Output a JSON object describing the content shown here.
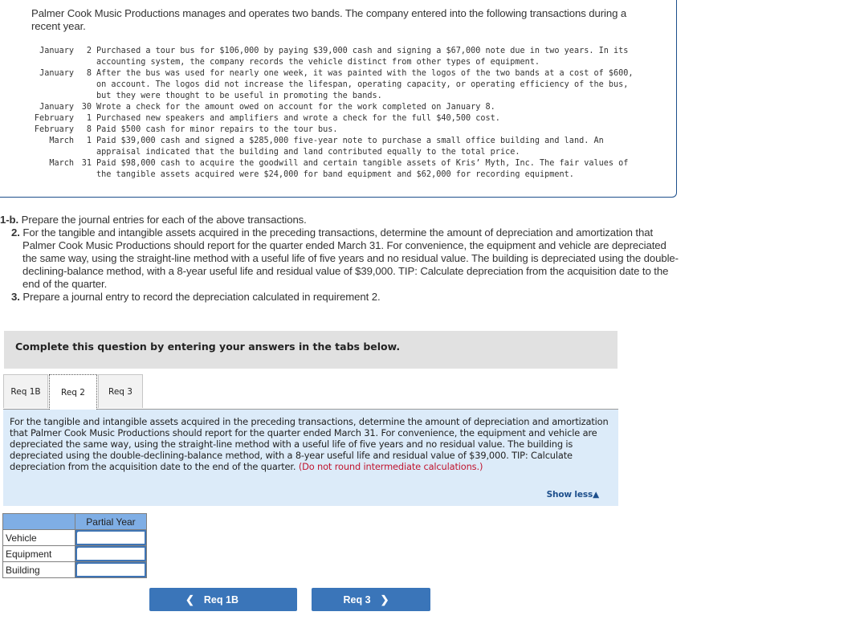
{
  "problem": {
    "intro": "Palmer Cook Music Productions manages and operates two bands. The company entered into the following transactions during a recent year.",
    "transactions": [
      {
        "month": "January",
        "day": "2",
        "description": "Purchased a tour bus for $106,000 by paying $39,000 cash and signing a $67,000 note due in two years. In its accounting system, the company records the vehicle distinct from other types of equipment."
      },
      {
        "month": "January",
        "day": "8",
        "description": "After the bus was used for nearly one week, it was painted with the logos of the two bands at a cost of $600, on account. The logos did not increase the lifespan, operating capacity, or operating efficiency of the bus, but they were thought to be useful in promoting the bands."
      },
      {
        "month": "January",
        "day": "30",
        "description": "Wrote a check for the amount owed on account for the work completed on January 8."
      },
      {
        "month": "February",
        "day": "1",
        "description": "Purchased new speakers and amplifiers and wrote a check for the full $40,500 cost."
      },
      {
        "month": "February",
        "day": "8",
        "description": "Paid $500 cash for minor repairs to the tour bus."
      },
      {
        "month": "March",
        "day": "1",
        "description": "Paid $39,000 cash and signed a $285,000 five-year note to purchase a small office building and land. An appraisal indicated that the building and land contributed equally to the total price."
      },
      {
        "month": "March",
        "day": "31",
        "description": "Paid $98,000 cash to acquire the goodwill and certain tangible assets of Kris’ Myth, Inc. The fair values of the tangible assets acquired were $24,000 for band equipment and $62,000 for recording equipment."
      }
    ]
  },
  "requirements": [
    {
      "label": "1-b.",
      "text": "Prepare the journal entries for each of the above transactions."
    },
    {
      "label": "2.",
      "text": "For the tangible and intangible assets acquired in the preceding transactions, determine the amount of depreciation and amortization that Palmer Cook Music Productions should report for the quarter ended March 31. For convenience, the equipment and vehicle are depreciated the same way, using the straight-line method with a useful life of five years and no residual value. The building is depreciated using the double-declining-balance method, with a 8-year useful life and residual value of $39,000. TIP: Calculate depreciation from the acquisition date to the end of the quarter."
    },
    {
      "label": "3.",
      "text": "Prepare a journal entry to record the depreciation calculated in requirement 2."
    }
  ],
  "complete_bar": "Complete this question by entering your answers in the tabs below.",
  "tabs": [
    {
      "label": "Req 1B",
      "active": false
    },
    {
      "label": "Req 2",
      "active": true
    },
    {
      "label": "Req 3",
      "active": false
    }
  ],
  "instructions": {
    "text": "For the tangible and intangible assets acquired in the preceding transactions, determine the amount of depreciation and amortization that Palmer Cook Music Productions should report for the quarter ended March 31. For convenience, the equipment and vehicle are depreciated the same way, using the straight-line method with a useful life of five years and no residual value. The building is depreciated using the double-declining-balance method, with a 8-year useful life and residual value of $39,000. TIP: Calculate depreciation from the acquisition date to the end of the quarter.",
    "warning": "(Do not round intermediate calculations.)",
    "show_less": "Show less",
    "show_less_icon": "triangle-up-icon"
  },
  "answer_table": {
    "column_header": "Partial Year",
    "rows": [
      {
        "label": "Vehicle",
        "value": ""
      },
      {
        "label": "Equipment",
        "value": ""
      },
      {
        "label": "Building",
        "value": ""
      }
    ]
  },
  "navigation": {
    "prev_label": "Req 1B",
    "prev_icon": "chevron-left-icon",
    "next_label": "Req 3",
    "next_icon": "chevron-right-icon"
  },
  "colors": {
    "border_blue": "#1d4f8c",
    "button_blue": "#3a75b9",
    "instructions_bg": "#dcebf9",
    "table_header_bg": "#7faee5",
    "warning_red": "#c0152f",
    "complete_bar_bg": "#e1e1e1"
  }
}
